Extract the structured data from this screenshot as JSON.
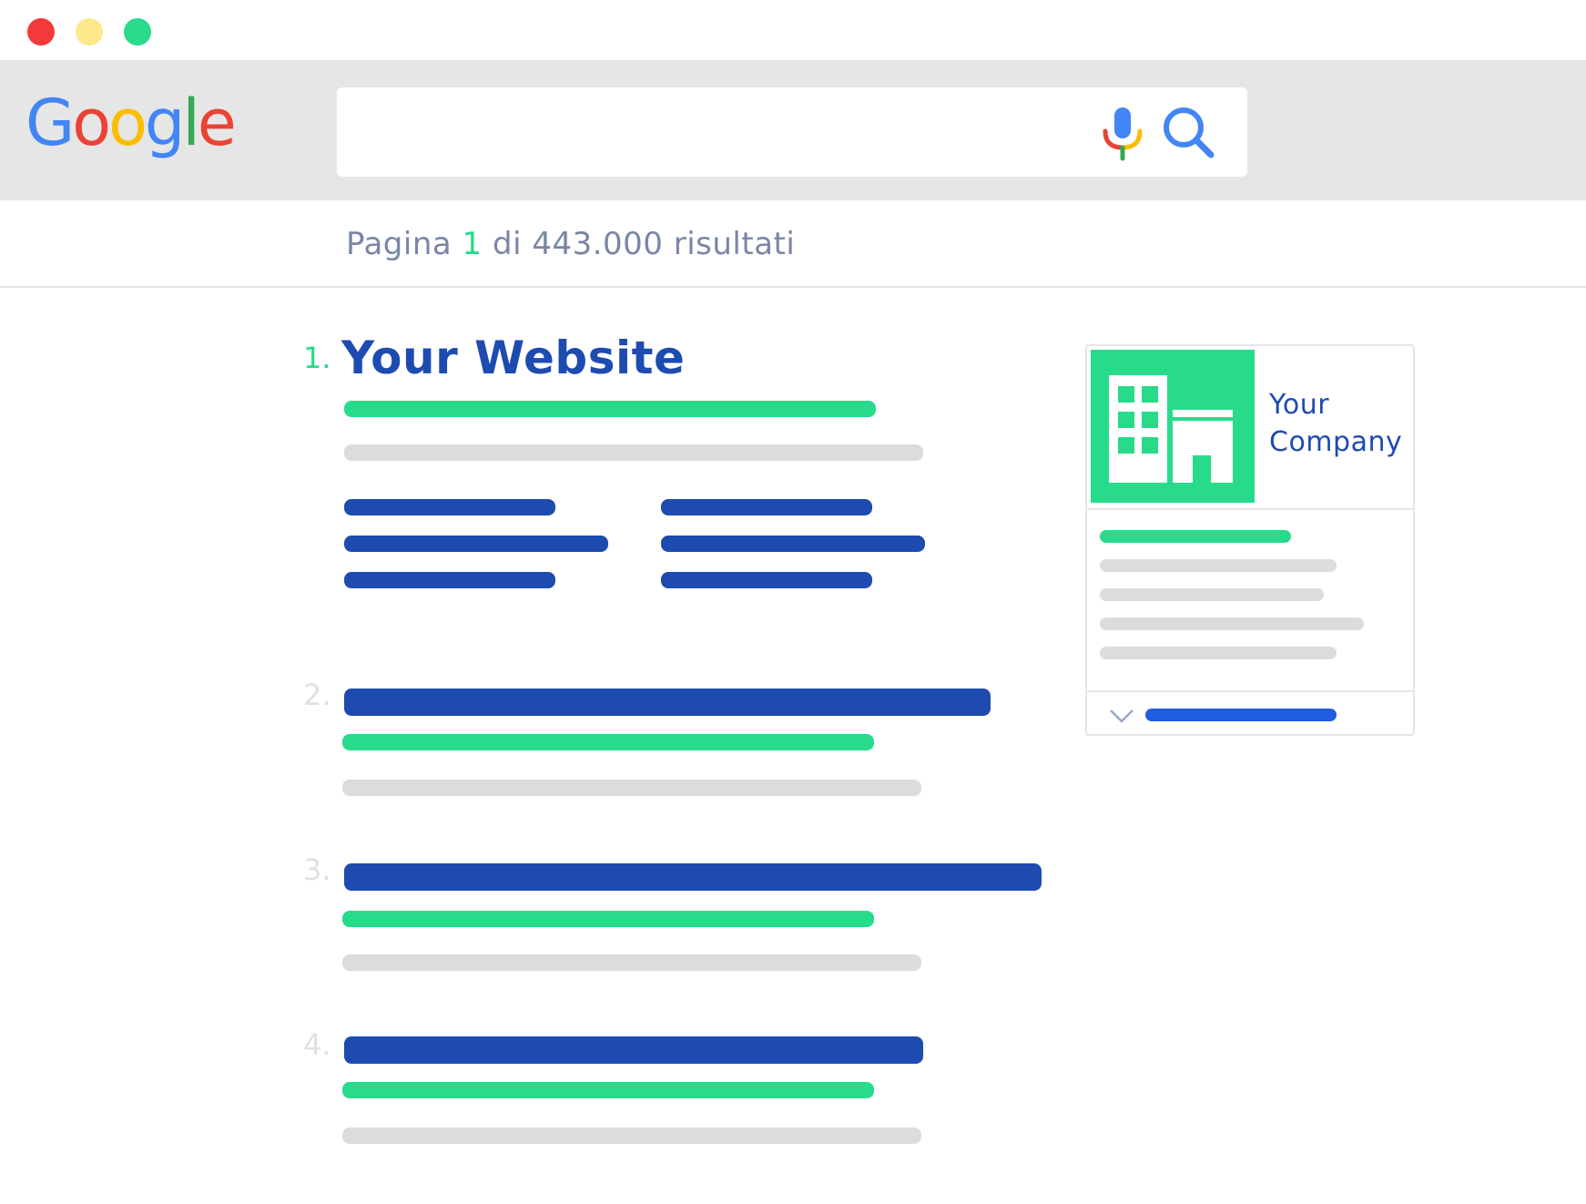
{
  "window": {
    "controls": [
      {
        "name": "close",
        "color": "#f23a3a"
      },
      {
        "name": "minimize",
        "color": "#fde98c"
      },
      {
        "name": "maximize",
        "color": "#27db8a"
      }
    ]
  },
  "header": {
    "logo_letters": [
      {
        "char": "G",
        "color": "#4285f4"
      },
      {
        "char": "o",
        "color": "#ea4335"
      },
      {
        "char": "o",
        "color": "#fbbc05"
      },
      {
        "char": "g",
        "color": "#4285f4"
      },
      {
        "char": "l",
        "color": "#34a853"
      },
      {
        "char": "e",
        "color": "#ea4335"
      }
    ],
    "search_value": "",
    "mic_icon": "microphone-icon",
    "search_icon": "magnifier-icon"
  },
  "results_info": {
    "prefix": "Pagina",
    "page": "1",
    "suffix": "di 443.000 risultati"
  },
  "results": [
    {
      "rank": "1.",
      "title": "Your Website"
    },
    {
      "rank": "2."
    },
    {
      "rank": "3."
    },
    {
      "rank": "4."
    }
  ],
  "knowledge_panel": {
    "company_name": "Your Company",
    "image_icon": "building-icon",
    "expand_icon": "chevron-down-icon"
  },
  "colors": {
    "accent_green": "#27db8a",
    "link_blue": "#1e4bb0",
    "placeholder_gray": "#dcdcdc"
  }
}
